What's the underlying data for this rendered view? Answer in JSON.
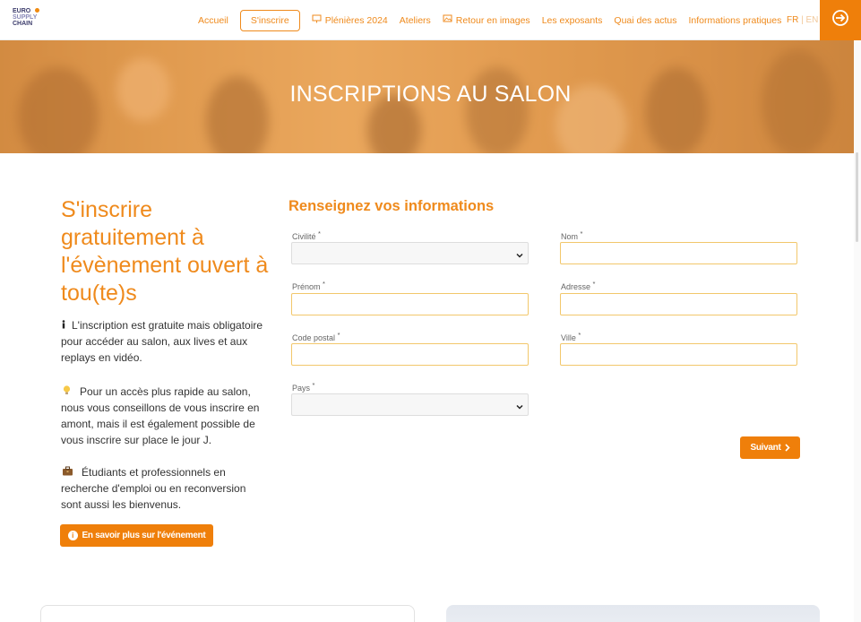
{
  "header": {
    "logo_lines": [
      "EURO",
      "SUPPLY",
      "CHAIN"
    ],
    "nav": [
      {
        "label": "Accueil",
        "icon": null
      },
      {
        "label": "S'inscrire",
        "icon": null,
        "active": true
      },
      {
        "label": "Plénières 2024",
        "icon": "presentation-icon"
      },
      {
        "label": "Ateliers",
        "icon": null
      },
      {
        "label": "Retour en images",
        "icon": "image-icon"
      },
      {
        "label": "Les exposants",
        "icon": null
      },
      {
        "label": "Quai des actus",
        "icon": null
      },
      {
        "label": "Informations pratiques",
        "icon": null
      }
    ],
    "lang_fr": "FR",
    "lang_sep": "|",
    "lang_en": "EN",
    "login_icon": "sign-in-arrow-icon"
  },
  "hero": {
    "title": "INSCRIPTIONS AU SALON"
  },
  "left": {
    "title": "S'inscrire gratuitement à l'évènement ouvert à tou(te)s",
    "p1_icon": "info-icon",
    "p1": "L'inscription est gratuite mais obligatoire pour accéder au salon, aux lives et aux replays en vidéo.",
    "p2_icon": "lightbulb-icon",
    "p2": "Pour un accès plus rapide au salon, nous vous conseillons de vous inscrire en amont, mais il est également possible de vous inscrire sur place le jour J.",
    "p3_icon": "briefcase-icon",
    "p3": "Étudiants et professionnels en recherche d'emploi ou en reconversion sont aussi les bienvenus.",
    "cta_label": "En savoir plus sur l'événement"
  },
  "form": {
    "title": "Renseignez vos informations",
    "civilite_label": "Civilité",
    "nom_label": "Nom",
    "prenom_label": "Prénom",
    "adresse_label": "Adresse",
    "code_postal_label": "Code postal",
    "ville_label": "Ville",
    "pays_label": "Pays",
    "required_mark": "*",
    "civilite_value": "",
    "nom_value": "",
    "prenom_value": "",
    "adresse_value": "",
    "code_postal_value": "",
    "ville_value": "",
    "pays_value": "",
    "next_label": "Suivant"
  },
  "colors": {
    "accent": "#ef7f0a",
    "accent_text": "#ef8a1c",
    "field_border": "#f2c76b"
  }
}
